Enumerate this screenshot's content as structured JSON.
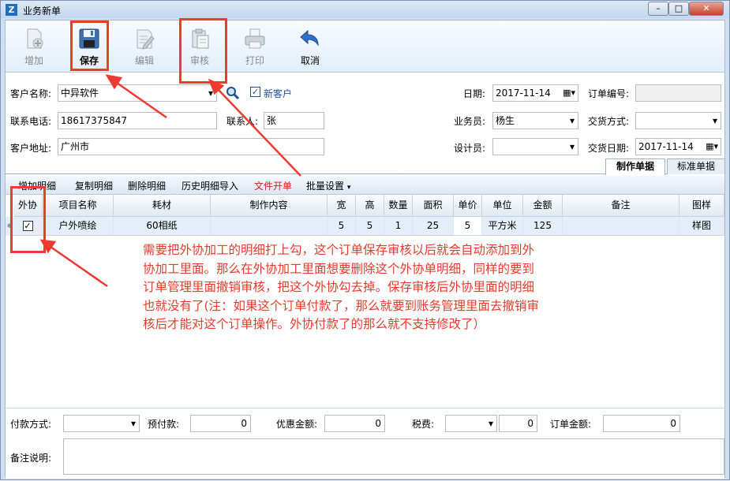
{
  "window": {
    "title": "业务新单",
    "app_icon_letter": "Z"
  },
  "toolbar": {
    "add": "增加",
    "save": "保存",
    "edit": "编辑",
    "audit": "审核",
    "print": "打印",
    "cancel": "取消"
  },
  "form": {
    "customer_name_label": "客户名称:",
    "customer_name": "中异软件",
    "new_customer_label": "新客户",
    "new_customer_checked": true,
    "date_label": "日期:",
    "date": "2017-11-14",
    "order_no_label": "订单编号:",
    "order_no": "",
    "phone_label": "联系电话:",
    "phone": "18617375847",
    "contact_label": "联系人:",
    "contact": "张",
    "salesman_label": "业务员:",
    "salesman": "杨生",
    "delivery_method_label": "交货方式:",
    "delivery_method": "",
    "address_label": "客户地址:",
    "address": "广州市",
    "designer_label": "设计员:",
    "designer": "",
    "delivery_date_label": "交货日期:",
    "delivery_date": "2017-11-14"
  },
  "tabs": [
    "制作单据",
    "标准单据"
  ],
  "detail_toolbar": {
    "add_detail": "增加明细",
    "copy_detail": "复制明细",
    "delete_detail": "删除明细",
    "history_import": "历史明细导入",
    "file_open": "文件开单",
    "batch_settings": "批量设置"
  },
  "grid": {
    "columns": [
      "外协",
      "项目名称",
      "耗材",
      "制作内容",
      "宽",
      "高",
      "数量",
      "面积",
      "单价",
      "单位",
      "金额",
      "备注",
      "图样"
    ],
    "rows": [
      {
        "outsource": true,
        "project": "户外喷绘",
        "material": "60相纸",
        "content": "",
        "width": "5",
        "height": "5",
        "qty": "1",
        "area": "25",
        "price": "5",
        "unit": "平方米",
        "amount": "125",
        "remark": "",
        "sample": "样图"
      }
    ]
  },
  "note": "需要把外协加工的明细打上勾，这个订单保存审核以后就会自动添加到外协加工里面。那么在外协加工里面想要删除这个外协单明细，同样的要到订单管理里面撤销审核，把这个外协勾去掉。保存审核后外协里面的明细也就没有了(注：如果这个订单付款了，那么就要到账务管理里面去撤销审核后才能对这个订单操作。外协付款了的那么就不支持修改了）",
  "footer": {
    "payment_method_label": "付款方式:",
    "payment_method": "",
    "prepaid_label": "预付款:",
    "prepaid": "0",
    "discount_label": "优惠金额:",
    "discount": "0",
    "tax_label": "税费:",
    "tax_type": "",
    "tax": "0",
    "order_amount_label": "订单金额:",
    "order_amount": "0",
    "remark_label": "备注说明:",
    "remark": ""
  },
  "colors": {
    "annotation": "#ee3b30",
    "note_text": "#e83a2c",
    "link_red": "#d42020",
    "tab_border": "#9fb3cc"
  },
  "icons": [
    "add-doc-icon",
    "floppy-save-icon",
    "edit-doc-icon",
    "clipboard-audit-icon",
    "printer-icon",
    "undo-arrow-icon",
    "search-magnifier-icon",
    "calendar-icon"
  ]
}
